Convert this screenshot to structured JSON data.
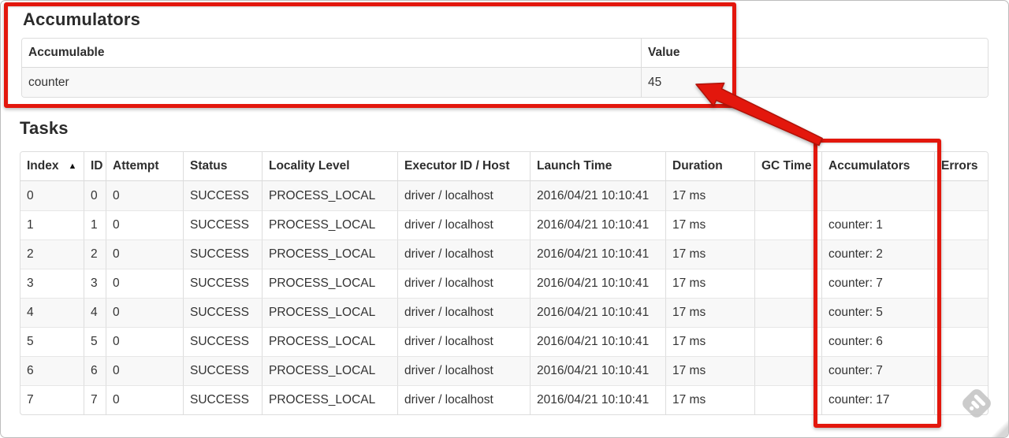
{
  "annotation": {
    "color": "#e3170d",
    "shapes": [
      "box-around-accumulators-section",
      "box-around-accumulators-column",
      "arrow-from-column-to-value-45"
    ]
  },
  "accumulators": {
    "title": "Accumulators",
    "headers": [
      "Accumulable",
      "Value"
    ],
    "row": {
      "name": "counter",
      "value": "45"
    }
  },
  "tasks": {
    "title": "Tasks",
    "sort_icon": "▲",
    "headers": [
      "Index",
      "ID",
      "Attempt",
      "Status",
      "Locality Level",
      "Executor ID / Host",
      "Launch Time",
      "Duration",
      "GC Time",
      "Accumulators",
      "Errors"
    ],
    "rows": [
      [
        "0",
        "0",
        "0",
        "SUCCESS",
        "PROCESS_LOCAL",
        "driver / localhost",
        "2016/04/21 10:10:41",
        "17 ms",
        "",
        "",
        ""
      ],
      [
        "1",
        "1",
        "0",
        "SUCCESS",
        "PROCESS_LOCAL",
        "driver / localhost",
        "2016/04/21 10:10:41",
        "17 ms",
        "",
        "counter: 1",
        ""
      ],
      [
        "2",
        "2",
        "0",
        "SUCCESS",
        "PROCESS_LOCAL",
        "driver / localhost",
        "2016/04/21 10:10:41",
        "17 ms",
        "",
        "counter: 2",
        ""
      ],
      [
        "3",
        "3",
        "0",
        "SUCCESS",
        "PROCESS_LOCAL",
        "driver / localhost",
        "2016/04/21 10:10:41",
        "17 ms",
        "",
        "counter: 7",
        ""
      ],
      [
        "4",
        "4",
        "0",
        "SUCCESS",
        "PROCESS_LOCAL",
        "driver / localhost",
        "2016/04/21 10:10:41",
        "17 ms",
        "",
        "counter: 5",
        ""
      ],
      [
        "5",
        "5",
        "0",
        "SUCCESS",
        "PROCESS_LOCAL",
        "driver / localhost",
        "2016/04/21 10:10:41",
        "17 ms",
        "",
        "counter: 6",
        ""
      ],
      [
        "6",
        "6",
        "0",
        "SUCCESS",
        "PROCESS_LOCAL",
        "driver / localhost",
        "2016/04/21 10:10:41",
        "17 ms",
        "",
        "counter: 7",
        ""
      ],
      [
        "7",
        "7",
        "0",
        "SUCCESS",
        "PROCESS_LOCAL",
        "driver / localhost",
        "2016/04/21 10:10:41",
        "17 ms",
        "",
        "counter: 17",
        ""
      ]
    ]
  },
  "watermark": {
    "icon": "feedly-logo"
  }
}
